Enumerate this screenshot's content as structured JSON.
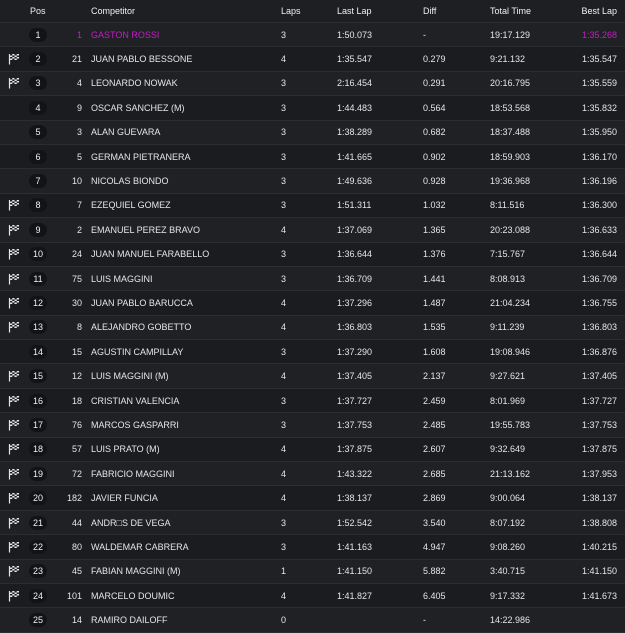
{
  "headers": {
    "pos": "Pos",
    "competitor": "Competitor",
    "laps": "Laps",
    "last_lap": "Last Lap",
    "diff": "Diff",
    "total_time": "Total Time",
    "best_lap": "Best Lap"
  },
  "colors": {
    "highlight": "#c21fc2"
  },
  "rows": [
    {
      "flag": false,
      "pos": "1",
      "num": "1",
      "name": "GASTON ROSSI",
      "laps": "3",
      "last": "1:50.073",
      "diff": "-",
      "total": "19:17.129",
      "best": "1:35.268",
      "highlight": true
    },
    {
      "flag": true,
      "pos": "2",
      "num": "21",
      "name": "JUAN PABLO BESSONE",
      "laps": "4",
      "last": "1:35.547",
      "diff": "0.279",
      "total": "9:21.132",
      "best": "1:35.547"
    },
    {
      "flag": true,
      "pos": "3",
      "num": "4",
      "name": "LEONARDO NOWAK",
      "laps": "3",
      "last": "2:16.454",
      "diff": "0.291",
      "total": "20:16.795",
      "best": "1:35.559"
    },
    {
      "flag": false,
      "pos": "4",
      "num": "9",
      "name": "OSCAR SANCHEZ (M)",
      "laps": "3",
      "last": "1:44.483",
      "diff": "0.564",
      "total": "18:53.568",
      "best": "1:35.832"
    },
    {
      "flag": false,
      "pos": "5",
      "num": "3",
      "name": "ALAN GUEVARA",
      "laps": "3",
      "last": "1:38.289",
      "diff": "0.682",
      "total": "18:37.488",
      "best": "1:35.950"
    },
    {
      "flag": false,
      "pos": "6",
      "num": "5",
      "name": "GERMAN PIETRANERA",
      "laps": "3",
      "last": "1:41.665",
      "diff": "0.902",
      "total": "18:59.903",
      "best": "1:36.170"
    },
    {
      "flag": false,
      "pos": "7",
      "num": "10",
      "name": "NICOLAS BIONDO",
      "laps": "3",
      "last": "1:49.636",
      "diff": "0.928",
      "total": "19:36.968",
      "best": "1:36.196"
    },
    {
      "flag": true,
      "pos": "8",
      "num": "7",
      "name": "EZEQUIEL GOMEZ",
      "laps": "3",
      "last": "1:51.311",
      "diff": "1.032",
      "total": "8:11.516",
      "best": "1:36.300"
    },
    {
      "flag": true,
      "pos": "9",
      "num": "2",
      "name": "EMANUEL PEREZ BRAVO",
      "laps": "4",
      "last": "1:37.069",
      "diff": "1.365",
      "total": "20:23.088",
      "best": "1:36.633"
    },
    {
      "flag": true,
      "pos": "10",
      "num": "24",
      "name": "JUAN MANUEL FARABELLO",
      "laps": "3",
      "last": "1:36.644",
      "diff": "1.376",
      "total": "7:15.767",
      "best": "1:36.644"
    },
    {
      "flag": true,
      "pos": "11",
      "num": "75",
      "name": "LUIS MAGGINI",
      "laps": "3",
      "last": "1:36.709",
      "diff": "1.441",
      "total": "8:08.913",
      "best": "1:36.709"
    },
    {
      "flag": true,
      "pos": "12",
      "num": "30",
      "name": "JUAN PABLO BARUCCA",
      "laps": "4",
      "last": "1:37.296",
      "diff": "1.487",
      "total": "21:04.234",
      "best": "1:36.755"
    },
    {
      "flag": true,
      "pos": "13",
      "num": "8",
      "name": "ALEJANDRO GOBETTO",
      "laps": "4",
      "last": "1:36.803",
      "diff": "1.535",
      "total": "9:11.239",
      "best": "1:36.803"
    },
    {
      "flag": false,
      "pos": "14",
      "num": "15",
      "name": "AGUSTIN CAMPILLAY",
      "laps": "3",
      "last": "1:37.290",
      "diff": "1.608",
      "total": "19:08.946",
      "best": "1:36.876"
    },
    {
      "flag": true,
      "pos": "15",
      "num": "12",
      "name": "LUIS MAGGINI (M)",
      "laps": "4",
      "last": "1:37.405",
      "diff": "2.137",
      "total": "9:27.621",
      "best": "1:37.405"
    },
    {
      "flag": true,
      "pos": "16",
      "num": "18",
      "name": "CRISTIAN VALENCIA",
      "laps": "3",
      "last": "1:37.727",
      "diff": "2.459",
      "total": "8:01.969",
      "best": "1:37.727"
    },
    {
      "flag": true,
      "pos": "17",
      "num": "76",
      "name": "MARCOS GASPARRI",
      "laps": "3",
      "last": "1:37.753",
      "diff": "2.485",
      "total": "19:55.783",
      "best": "1:37.753"
    },
    {
      "flag": true,
      "pos": "18",
      "num": "57",
      "name": "LUIS PRATO (M)",
      "laps": "4",
      "last": "1:37.875",
      "diff": "2.607",
      "total": "9:32.649",
      "best": "1:37.875"
    },
    {
      "flag": true,
      "pos": "19",
      "num": "72",
      "name": "FABRICIO MAGGINI",
      "laps": "4",
      "last": "1:43.322",
      "diff": "2.685",
      "total": "21:13.162",
      "best": "1:37.953"
    },
    {
      "flag": true,
      "pos": "20",
      "num": "182",
      "name": "JAVIER FUNCIA",
      "laps": "4",
      "last": "1:38.137",
      "diff": "2.869",
      "total": "9:00.064",
      "best": "1:38.137"
    },
    {
      "flag": true,
      "pos": "21",
      "num": "44",
      "name": "ANDR□S DE VEGA",
      "laps": "3",
      "last": "1:52.542",
      "diff": "3.540",
      "total": "8:07.192",
      "best": "1:38.808"
    },
    {
      "flag": true,
      "pos": "22",
      "num": "80",
      "name": "WALDEMAR CABRERA",
      "laps": "3",
      "last": "1:41.163",
      "diff": "4.947",
      "total": "9:08.260",
      "best": "1:40.215"
    },
    {
      "flag": true,
      "pos": "23",
      "num": "45",
      "name": "FABIAN MAGGINI (M)",
      "laps": "1",
      "last": "1:41.150",
      "diff": "5.882",
      "total": "3:40.715",
      "best": "1:41.150"
    },
    {
      "flag": true,
      "pos": "24",
      "num": "101",
      "name": "MARCELO DOUMIC",
      "laps": "4",
      "last": "1:41.827",
      "diff": "6.405",
      "total": "9:17.332",
      "best": "1:41.673"
    },
    {
      "flag": false,
      "pos": "25",
      "num": "14",
      "name": "RAMIRO DAILOFF",
      "laps": "0",
      "last": "",
      "diff": "-",
      "total": "14:22.986",
      "best": ""
    }
  ]
}
